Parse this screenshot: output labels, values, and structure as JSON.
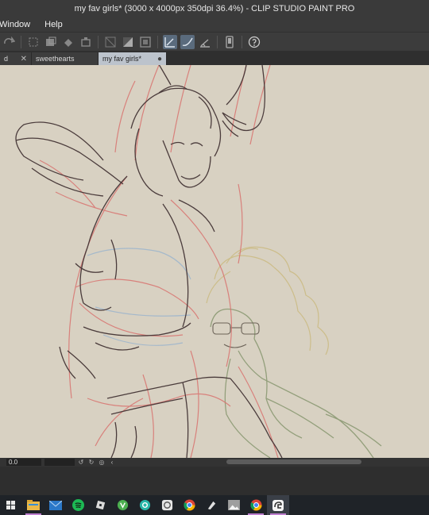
{
  "window": {
    "title": "my fav girls* (3000 x 4000px 350dpi 36.4%)  - CLIP STUDIO PAINT PRO"
  },
  "menu": {
    "items": [
      "Window",
      "Help"
    ]
  },
  "tabs": [
    {
      "label": "d",
      "active": false
    },
    {
      "label": "sweethearts",
      "active": false
    },
    {
      "label": "my fav girls*",
      "active": true
    }
  ],
  "status": {
    "zoom": "0.0"
  },
  "colors": {
    "canvas_bg": "#d8d1c2",
    "sketch_red": "#d9736f",
    "sketch_dark": "#4a3b3b",
    "sketch_blue": "#9fb6cc",
    "sketch_yellow": "#cbbb84",
    "sketch_green": "#8c9a74"
  },
  "taskbar": {
    "icons": [
      "windows-icon",
      "file-explorer-icon",
      "mail-icon",
      "spotify-icon",
      "roblox-icon",
      "vpn-icon",
      "app-icon",
      "printer-icon",
      "chrome-icon",
      "pen-tool-icon",
      "photos-icon",
      "chrome-profile-icon",
      "clip-studio-icon"
    ]
  }
}
